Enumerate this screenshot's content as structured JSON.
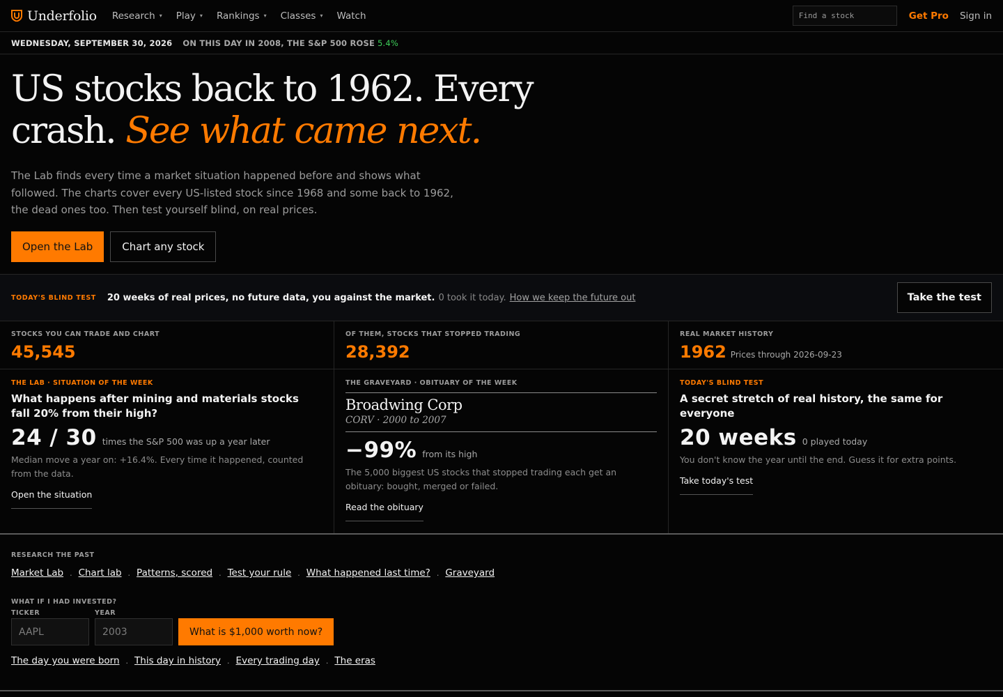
{
  "nav": {
    "brand": "Underfolio",
    "items": [
      {
        "label": "Research",
        "has_menu": true
      },
      {
        "label": "Play",
        "has_menu": true
      },
      {
        "label": "Rankings",
        "has_menu": true
      },
      {
        "label": "Classes",
        "has_menu": true
      },
      {
        "label": "Watch",
        "has_menu": false
      }
    ],
    "search_placeholder": "Find a stock",
    "get_pro": "Get Pro",
    "sign_in": "Sign in"
  },
  "datebar": {
    "date": "WEDNESDAY, SEPTEMBER 30, 2026",
    "on_this_day": "ON THIS DAY IN 2008, THE S&P 500 ROSE",
    "change": "5.4%"
  },
  "hero": {
    "headline_plain": "US stocks back to 1962. Every crash.",
    "headline_accent": "See what came next.",
    "lede": "The Lab finds every time a market situation happened before and shows what followed. The charts cover every US-listed stock since 1968 and some back to 1962, the dead ones too. Then test yourself blind, on real prices.",
    "primary_button": "Open the Lab",
    "secondary_button": "Chart any stock"
  },
  "blind_test_bar": {
    "tag": "TODAY'S BLIND TEST",
    "main": "20 weeks of real prices, no future data, you against the market.",
    "count": "0 took it today.",
    "link": "How we keep the future out",
    "button": "Take the test"
  },
  "stats": [
    {
      "label": "STOCKS YOU CAN TRADE AND CHART",
      "value": "45,545",
      "sub": ""
    },
    {
      "label": "OF THEM, STOCKS THAT STOPPED TRADING",
      "value": "28,392",
      "sub": ""
    },
    {
      "label": "REAL MARKET HISTORY",
      "value": "1962",
      "sub": "Prices through 2026-09-23"
    }
  ],
  "cards": {
    "lab": {
      "tag": "THE LAB · SITUATION OF THE WEEK",
      "title": "What happens after mining and materials stocks fall 20% from their high?",
      "big": "24 / 30",
      "big_sub": "times the S&P 500 was up a year later",
      "desc": "Median move a year on: +16.4%. Every time it happened, counted from the data.",
      "link": "Open the situation"
    },
    "graveyard": {
      "tag": "THE GRAVEYARD · OBITUARY OF THE WEEK",
      "name": "Broadwing Corp",
      "meta": "CORV · 2000 to 2007",
      "big": "−99%",
      "big_sub": "from its high",
      "desc": "The 5,000 biggest US stocks that stopped trading each get an obituary: bought, merged or failed.",
      "link": "Read the obituary"
    },
    "blind": {
      "tag": "TODAY'S BLIND TEST",
      "title": "A secret stretch of real history, the same for everyone",
      "big": "20 weeks",
      "big_sub": "0 played today",
      "desc": "You don't know the year until the end. Guess it for extra points.",
      "link": "Take today's test"
    }
  },
  "research": {
    "label": "RESEARCH THE PAST",
    "links": [
      "Market Lab",
      "Chart lab",
      "Patterns, scored",
      "Test your rule",
      "What happened last time?",
      "Graveyard"
    ],
    "separator": "·",
    "invest_label": "WHAT IF I HAD INVESTED?",
    "ticker_label": "TICKER",
    "year_label": "YEAR",
    "ticker_placeholder": "AAPL",
    "year_placeholder": "2003",
    "worth_button": "What is $1,000 worth now?",
    "links2": [
      "The day you were born",
      "This day in history",
      "Every trading day",
      "The eras"
    ]
  },
  "colors": {
    "accent": "#ff7a00",
    "positive": "#3ecf5a",
    "background": "#050505"
  },
  "icons": {
    "logo": "shield-u-logo-icon",
    "menu_caret": "caret-down-icon"
  }
}
